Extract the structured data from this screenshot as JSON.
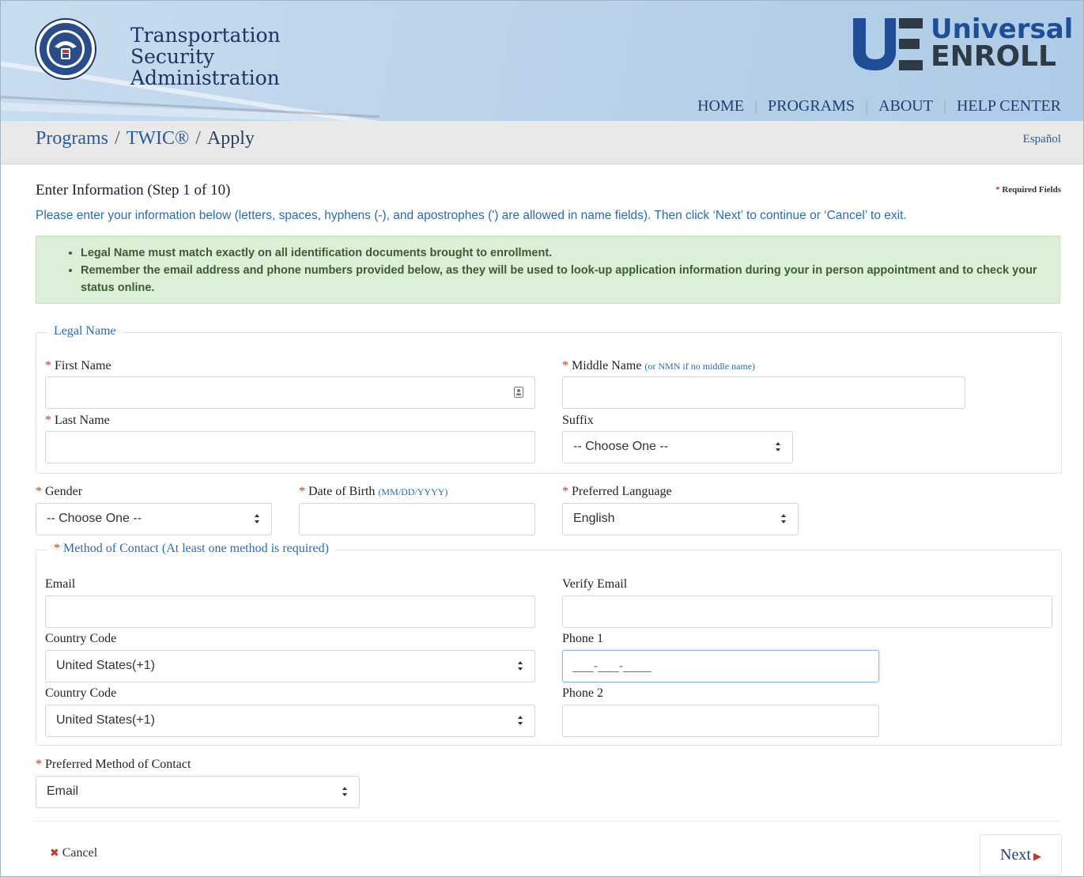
{
  "header": {
    "agency_line1": "Transportation",
    "agency_line2": "Security",
    "agency_line3": "Administration",
    "brand_line1": "Universal",
    "brand_line2": "ENROLL",
    "nav": [
      "HOME",
      "PROGRAMS",
      "ABOUT",
      "HELP CENTER"
    ]
  },
  "breadcrumb": {
    "items": [
      "Programs",
      "TWIC®",
      "Apply"
    ],
    "language_link": "Español"
  },
  "form": {
    "step_title": "Enter Information (Step 1 of 10)",
    "required_note": "Required Fields",
    "instructions": "Please enter your information below (letters, spaces, hyphens (-), and apostrophes (') are allowed in name fields). Then click ‘Next’ to continue or ‘Cancel’ to exit.",
    "notices": [
      "Legal Name must match exactly on all identification documents brought to enrollment.",
      "Remember the email address and phone numbers provided below, as they will be used to look-up application information during your in person appointment and to check your status online."
    ],
    "legal_name": {
      "legend": "Legal Name",
      "first_name_label": "First Name",
      "first_name_value": "",
      "middle_name_label": "Middle Name",
      "middle_name_hint": "(or NMN if no middle name)",
      "middle_name_value": "",
      "last_name_label": "Last Name",
      "last_name_value": "",
      "suffix_label": "Suffix",
      "suffix_value": "-- Choose One --"
    },
    "gender_label": "Gender",
    "gender_value": "-- Choose One --",
    "dob_label": "Date of Birth",
    "dob_hint": "(MM/DD/YYYY)",
    "dob_value": "",
    "language_label": "Preferred Language",
    "language_value": "English",
    "contact": {
      "legend": "Method of Contact (At least one method is required)",
      "email_label": "Email",
      "email_value": "",
      "verify_email_label": "Verify Email",
      "verify_email_value": "",
      "country_code_label_1": "Country Code",
      "country_code_value_1": "United States(+1)",
      "phone1_label": "Phone 1",
      "phone1_mask": "___-___-____",
      "country_code_label_2": "Country Code",
      "country_code_value_2": "United States(+1)",
      "phone2_label": "Phone 2",
      "phone2_value": ""
    },
    "preferred_contact_label": "Preferred Method of Contact",
    "preferred_contact_value": "Email",
    "cancel_label": "Cancel",
    "next_label": "Next"
  },
  "colors": {
    "link_blue": "#2a5a9a",
    "required_red": "#c0392b",
    "notice_green": "#dcefd7",
    "brand_blue": "#1f4e96"
  }
}
